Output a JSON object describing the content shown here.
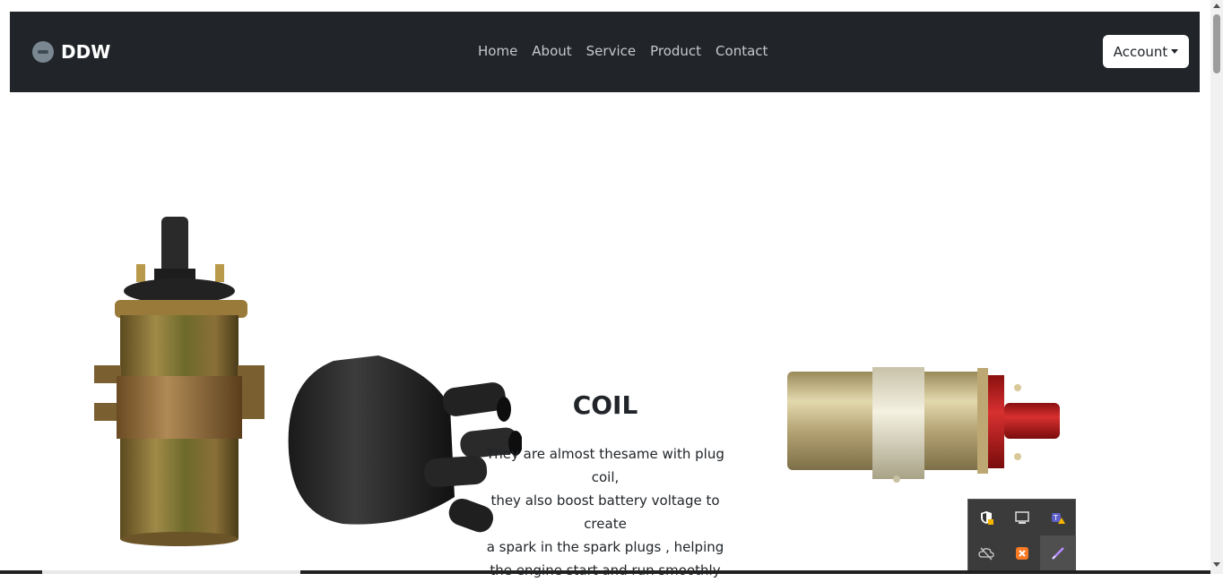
{
  "navbar": {
    "brand": "DDW",
    "links": [
      "Home",
      "About",
      "Service",
      "Product",
      "Contact"
    ],
    "account_label": "Account"
  },
  "hero": {
    "title": "COIL",
    "lines": [
      "They are almost thesame with plug coil,",
      "they also boost battery voltage to create",
      "a spark in the spark plugs , helping",
      "the engine start and run smoothly"
    ]
  },
  "tray_icons": [
    "windows-security-icon",
    "display-icon",
    "teams-warning-icon",
    "cloud-off-icon",
    "xampp-icon",
    "pen-icon"
  ]
}
